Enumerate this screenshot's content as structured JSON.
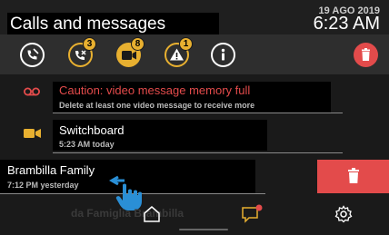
{
  "header": {
    "title": "Calls and messages",
    "date": "19 AGO 2019",
    "time": "6:23 AM"
  },
  "toolbar": {
    "buttons": [
      {
        "icon": "phone-settings-icon",
        "badge": ""
      },
      {
        "icon": "missed-call-icon",
        "badge": "3"
      },
      {
        "icon": "video-message-icon",
        "badge": "8"
      },
      {
        "icon": "alarm-warning-icon",
        "badge": "1"
      },
      {
        "icon": "info-icon",
        "badge": ""
      },
      {
        "icon": "trash-icon",
        "badge": ""
      }
    ]
  },
  "messages": [
    {
      "icon": "voicemail-icon",
      "title": "Caution: video message memory full",
      "subtitle": "Delete at least one video message to receive more"
    },
    {
      "icon": "video-camera-icon",
      "title": "Switchboard",
      "subtitle": "5:23 AM today"
    },
    {
      "icon": "",
      "title": "Brambilla Family",
      "subtitle": "7:12 PM yesterday"
    }
  ],
  "ghost_row": {
    "text": "da Famiglia Brambilla"
  },
  "navbar": {
    "items": [
      "home-icon",
      "chat-icon",
      "settings-icon"
    ]
  },
  "colors": {
    "accent_yellow": "#e8b030",
    "alert_red": "#e34b4b",
    "background": "#1a1a1a"
  }
}
